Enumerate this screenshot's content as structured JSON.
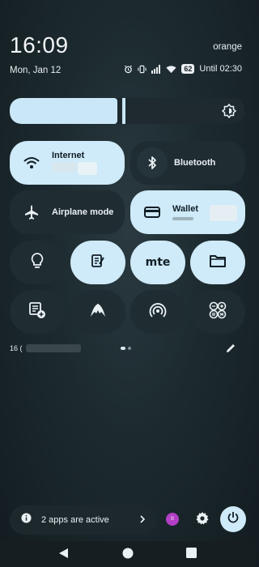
{
  "status": {
    "time": "16:09",
    "date": "Mon, Jan 12",
    "carrier": "orange",
    "battery": "62",
    "alarm_text": "Until 02:30"
  },
  "brightness": {
    "level": 0.48
  },
  "tiles": {
    "internet": {
      "label": "Internet",
      "state": "on"
    },
    "bluetooth": {
      "label": "Bluetooth",
      "state": "off"
    },
    "airplane": {
      "label": "Airplane mode",
      "state": "off"
    },
    "wallet": {
      "label": "Wallet",
      "state": "on"
    }
  },
  "round_tiles": [
    {
      "icon": "bulb-icon",
      "state": "off"
    },
    {
      "icon": "notes-icon",
      "state": "on"
    },
    {
      "icon": "mte-icon",
      "state": "on",
      "text": "mte"
    },
    {
      "icon": "folder-icon",
      "state": "on"
    },
    {
      "icon": "add-stack-icon",
      "state": "off"
    },
    {
      "icon": "vpn-mountain-icon",
      "state": "off"
    },
    {
      "icon": "hotspot-icon",
      "state": "off"
    },
    {
      "icon": "calculator-icon",
      "state": "off"
    }
  ],
  "footer": {
    "user_prefix": "16 (",
    "apps_active": "2 apps are active",
    "avatar_letter": "B"
  },
  "colors": {
    "tile_on": "#cfeaf8",
    "tile_off": "#1f2c32",
    "avatar": "#b33fc6"
  }
}
